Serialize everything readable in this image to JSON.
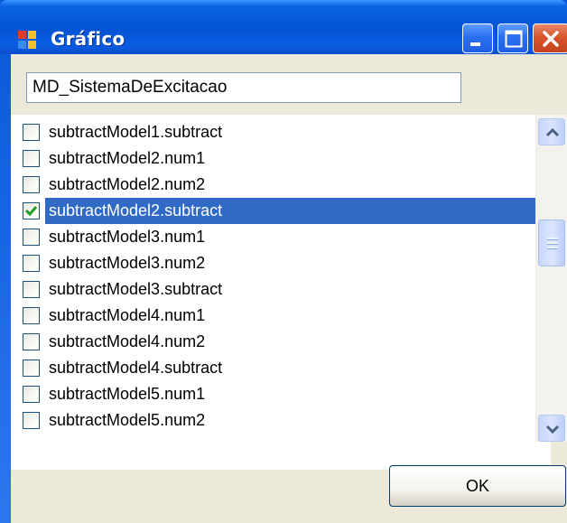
{
  "window": {
    "title": "Gráfico",
    "icon": "app-window-icon",
    "controls": [
      "minimize-icon",
      "maximize-icon",
      "close-icon"
    ]
  },
  "name_field": {
    "value": "MD_SistemaDeExcitacao"
  },
  "list": {
    "items": [
      {
        "label": "subtractModel1.subtract",
        "checked": false,
        "selected": false
      },
      {
        "label": "subtractModel2.num1",
        "checked": false,
        "selected": false
      },
      {
        "label": "subtractModel2.num2",
        "checked": false,
        "selected": false
      },
      {
        "label": "subtractModel2.subtract",
        "checked": true,
        "selected": true
      },
      {
        "label": "subtractModel3.num1",
        "checked": false,
        "selected": false
      },
      {
        "label": "subtractModel3.num2",
        "checked": false,
        "selected": false
      },
      {
        "label": "subtractModel3.subtract",
        "checked": false,
        "selected": false
      },
      {
        "label": "subtractModel4.num1",
        "checked": false,
        "selected": false
      },
      {
        "label": "subtractModel4.num2",
        "checked": false,
        "selected": false
      },
      {
        "label": "subtractModel4.subtract",
        "checked": false,
        "selected": false
      },
      {
        "label": "subtractModel5.num1",
        "checked": false,
        "selected": false
      },
      {
        "label": "subtractModel5.num2",
        "checked": false,
        "selected": false
      }
    ]
  },
  "buttons": {
    "ok_label": "OK"
  },
  "colors": {
    "title_bar": "#0554d6",
    "selection": "#316ac5",
    "check_mark": "#21a121",
    "close_button": "#d8542c",
    "dialog_face": "#ece9d8"
  }
}
